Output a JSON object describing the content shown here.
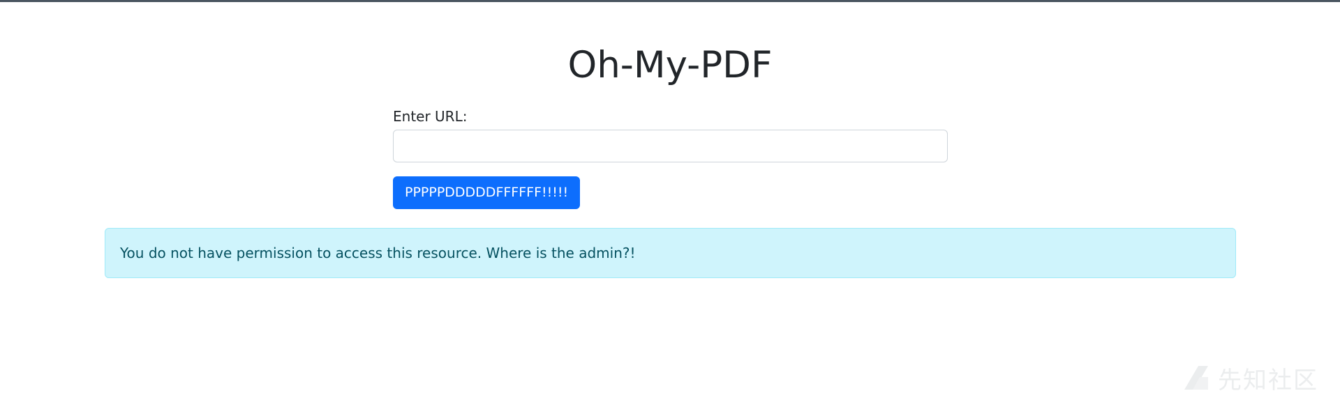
{
  "page": {
    "title": "Oh-My-PDF"
  },
  "form": {
    "label": "Enter URL:",
    "url_value": "",
    "url_placeholder": "",
    "submit_label": "PPPPPDDDDDFFFFFF!!!!!"
  },
  "alert": {
    "message": "You do not have permission to access this resource. Where is the admin?!"
  },
  "watermark": {
    "text": "先知社区"
  },
  "colors": {
    "primary_button": "#0d6efd",
    "alert_background": "#cff4fc",
    "alert_border": "#9eeaf9",
    "alert_text": "#055160",
    "title_text": "#212529"
  }
}
